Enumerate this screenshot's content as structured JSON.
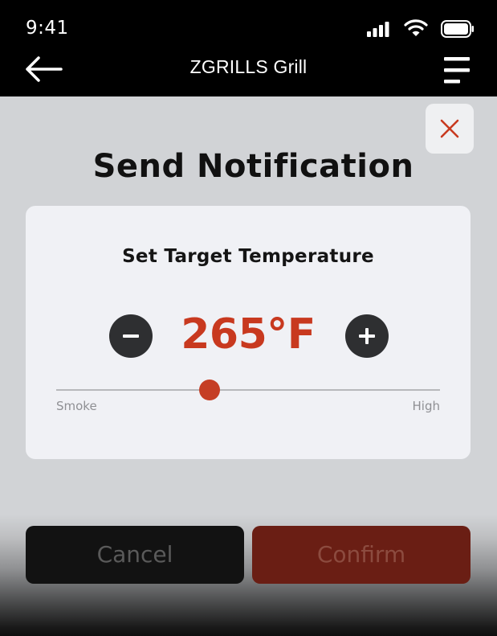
{
  "status_bar": {
    "time": "9:41"
  },
  "nav": {
    "title": "ZGRILLS Grill"
  },
  "dialog": {
    "title": "Send Notification",
    "card_title": "Set Target Temperature",
    "temperature": "265°F",
    "slider": {
      "min_label": "Smoke",
      "max_label": "High",
      "level_fraction": 0.4
    },
    "cancel_label": "Cancel",
    "confirm_label": "Confirm"
  },
  "colors": {
    "accent": "#c8391f",
    "button_dark": "#2e2f31",
    "overlay": "#d1d3d6",
    "card": "#f0f1f5"
  },
  "icons": [
    "signal-icon",
    "wifi-icon",
    "battery-icon",
    "back-arrow-icon",
    "menu-icon",
    "close-icon",
    "minus-icon",
    "plus-icon"
  ]
}
